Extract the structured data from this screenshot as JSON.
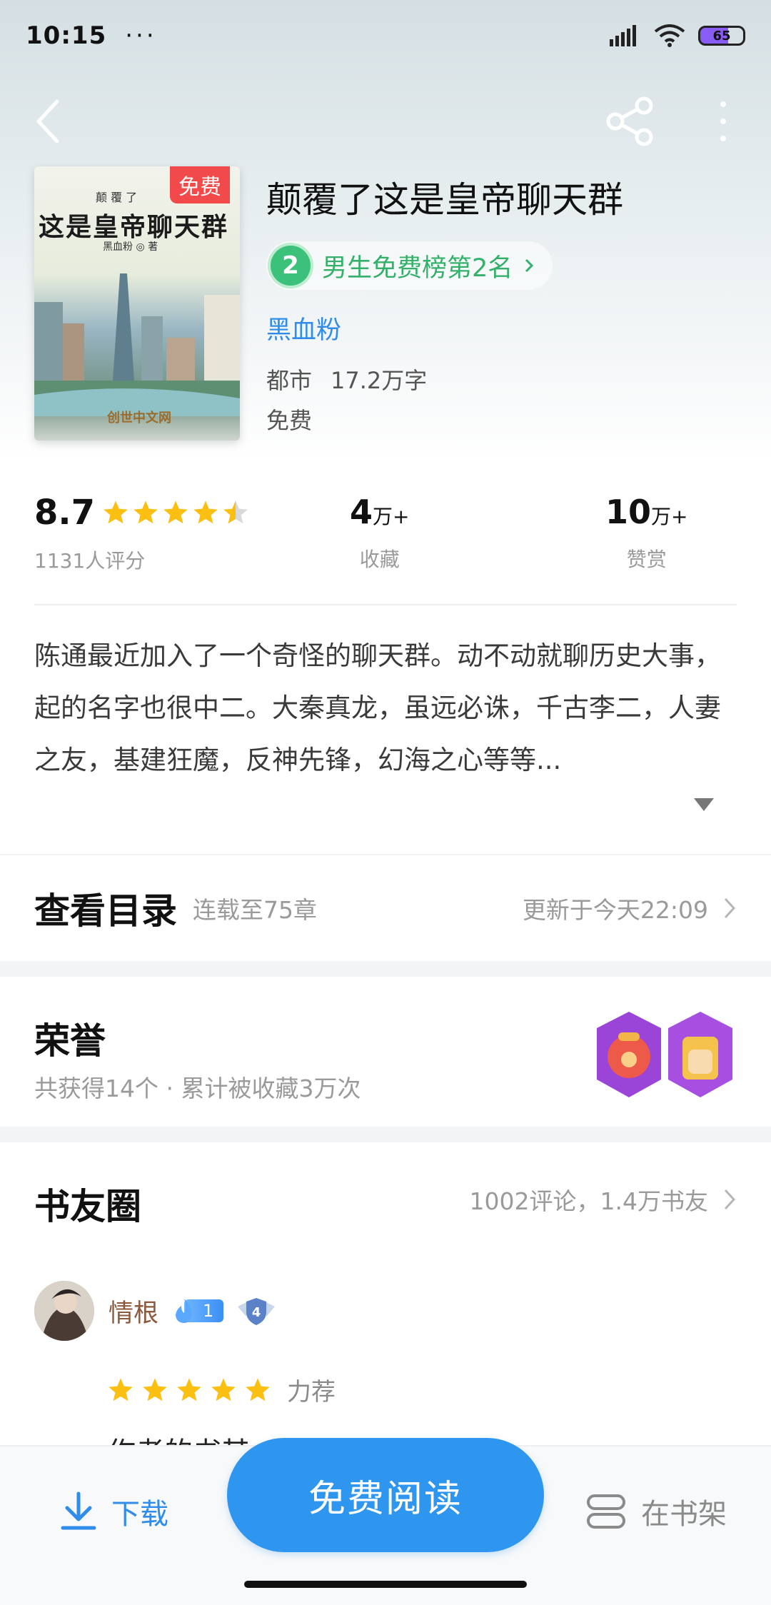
{
  "status_bar": {
    "time": "10:15",
    "dots": "···",
    "battery": "65"
  },
  "book": {
    "title": "颠覆了这是皇帝聊天群",
    "rank_number": "2",
    "rank_text": "男生免费榜第2名",
    "author": "黑血粉",
    "category": "都市",
    "word_count": "17.2万字",
    "price": "免费",
    "cover": {
      "badge": "免费",
      "subtitle": "颠 覆 了",
      "title": "这是皇帝聊天群",
      "author": "黑血粉 ◎ 著",
      "logo": "创世中文网"
    }
  },
  "stats": {
    "rating_value": "8.7",
    "rating_stars": 4.5,
    "rating_count": "1131人评分",
    "favorites_value": "4",
    "favorites_unit": "万+",
    "favorites_label": "收藏",
    "rewards_value": "10",
    "rewards_unit": "万+",
    "rewards_label": "赞赏"
  },
  "intro": {
    "text": "陈通最近加入了一个奇怪的聊天群。动不动就聊历史大事，起的名字也很中二。大秦真龙，虽远必诛，千古李二，人妻之友，基建狂魔，反神先锋，幻海之心等等..."
  },
  "toc": {
    "title": "查看目录",
    "progress": "连载至75章",
    "updated": "更新于今天22:09"
  },
  "honor": {
    "title": "荣誉",
    "summary": "共获得14个 · 累计被收藏3万次"
  },
  "circle": {
    "title": "书友圈",
    "summary": "1002评论，1.4万书友",
    "review": {
      "user_name": "情根",
      "fan_level": "1",
      "shield_level": "4",
      "stars": 5,
      "tag": "力荐",
      "text_peek": "作者的书其"
    }
  },
  "bottom_bar": {
    "download_label": "下载",
    "read_label": "免费阅读",
    "shelf_label": "在书架"
  },
  "colors": {
    "accent_blue": "#2f96f0",
    "rank_green": "#3cc17b",
    "star_yellow": "#fbbf12",
    "cover_badge_red": "#f24a4a"
  }
}
